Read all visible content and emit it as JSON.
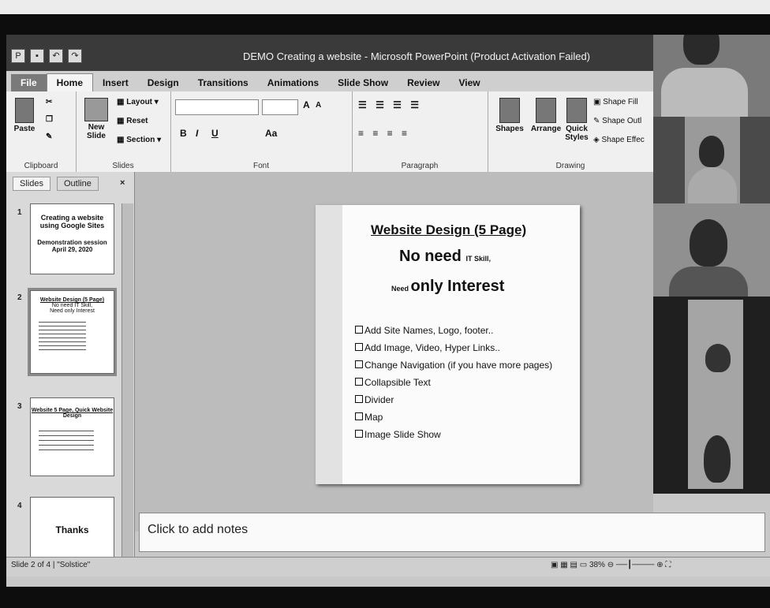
{
  "window": {
    "title": "DEMO Creating a website - Microsoft PowerPoint (Product Activation Failed)"
  },
  "ribbon_tabs": [
    "File",
    "Home",
    "Insert",
    "Design",
    "Transitions",
    "Animations",
    "Slide Show",
    "Review",
    "View"
  ],
  "ribbon": {
    "clipboard": {
      "paste": "Paste",
      "label": "Clipboard"
    },
    "slides": {
      "new_slide": "New Slide",
      "layout": "Layout",
      "reset": "Reset",
      "section": "Section",
      "label": "Slides"
    },
    "font": {
      "label": "Font",
      "bold": "B",
      "italic": "I",
      "underline": "U",
      "grow": "A",
      "shrink": "A",
      "aa": "Aa"
    },
    "paragraph": {
      "label": "Paragraph"
    },
    "drawing": {
      "shapes": "Shapes",
      "arrange": "Arrange",
      "quick_styles": "Quick Styles",
      "shape_fill": "Shape Fill",
      "shape_outline": "Shape Outl",
      "shape_effects": "Shape Effec",
      "label": "Drawing"
    }
  },
  "left_panel": {
    "tabs": [
      "Slides",
      "Outline"
    ],
    "close": "×",
    "thumbnails": [
      {
        "num": "1",
        "lines": [
          "Creating a website",
          "using Google Sites",
          "Demonstration session",
          "April 29, 2020"
        ]
      },
      {
        "num": "2",
        "lines": [
          "Website Design (5 Page)",
          "No need IT Skill,",
          "Need only Interest"
        ]
      },
      {
        "num": "3",
        "lines": [
          "Website 5 Page, Quick Website",
          "Design"
        ]
      },
      {
        "num": "4",
        "lines": [
          "Thanks"
        ]
      }
    ]
  },
  "slide": {
    "title": "Website Design (5 Page)",
    "line2_main": "No need ",
    "line2_small": "IT Skill,",
    "line3_small": "Need ",
    "line3_main": "only Interest",
    "bullets": [
      "Add Site Names, Logo, footer..",
      "Add Image, Video, Hyper Links..",
      "Change Navigation (if you have more pages)",
      "Collapsible Text",
      "Divider",
      "Map",
      "Image Slide Show"
    ]
  },
  "notes": {
    "placeholder": "Click to add notes"
  },
  "statusbar": {
    "slide_info": "Slide 2 of 4",
    "theme": "\"Solstice\"",
    "zoom": "38%"
  },
  "icons": [
    "paste-icon",
    "cut-icon",
    "copy-icon",
    "format-painter-icon",
    "new-slide-icon",
    "layout-icon",
    "shapes-icon",
    "arrange-icon",
    "quick-styles-icon",
    "zoom-slider-icon",
    "fit-window-icon"
  ]
}
